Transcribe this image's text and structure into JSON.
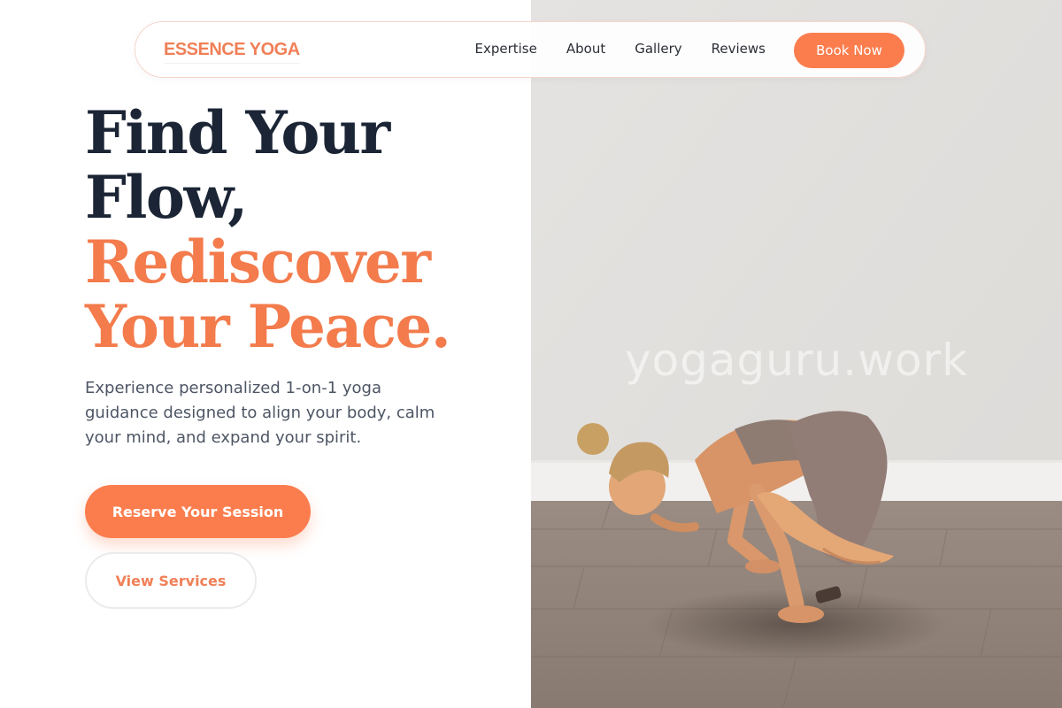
{
  "header": {
    "brand": "ESSENCE YOGA",
    "nav_items": [
      {
        "label": "Expertise"
      },
      {
        "label": "About"
      },
      {
        "label": "Gallery"
      },
      {
        "label": "Reviews"
      }
    ],
    "book_label": "Book Now"
  },
  "hero": {
    "headline_dark_1": "Find Your",
    "headline_dark_2": "Flow,",
    "headline_accent_1": "Rediscover",
    "headline_accent_2": "Your Peace.",
    "subtext": "Experience personalized 1-on-1 yoga guidance designed to align your body, calm your mind, and expand your spirit.",
    "primary_cta": "Reserve Your Session",
    "secondary_cta": "View Services"
  },
  "photo": {
    "watermark": "yogaguru.work"
  },
  "colors": {
    "accent": "#fb7d4e",
    "heading_dark": "#1b2535",
    "body_text": "#4d5564"
  }
}
